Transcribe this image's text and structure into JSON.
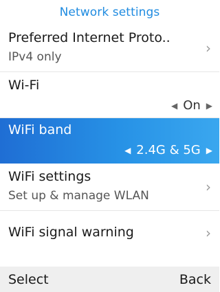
{
  "header": {
    "title": "Network settings"
  },
  "items": [
    {
      "title": "Preferred Internet Proto..",
      "subtitle": "IPv4 only",
      "icon": "chevron-right-icon",
      "chevron": "›"
    },
    {
      "title": "Wi-Fi",
      "value": "On",
      "left_arrow": "◀",
      "right_arrow": "▶"
    },
    {
      "title": "WiFi band",
      "value": "2.4G & 5G",
      "left_arrow": "◀",
      "right_arrow": "▶",
      "selected": true
    },
    {
      "title": "WiFi settings",
      "subtitle": "Set up & manage WLAN",
      "icon": "chevron-right-icon",
      "chevron": "›"
    },
    {
      "title": "WiFi signal warning",
      "icon": "chevron-right-icon",
      "chevron": "›"
    }
  ],
  "softkeys": {
    "left": "Select",
    "right": "Back"
  },
  "colors": {
    "accent": "#1f8be0",
    "selection_start": "#1f6ed4",
    "selection_end": "#3aa7ef",
    "softkey_bar": "#efefef"
  }
}
